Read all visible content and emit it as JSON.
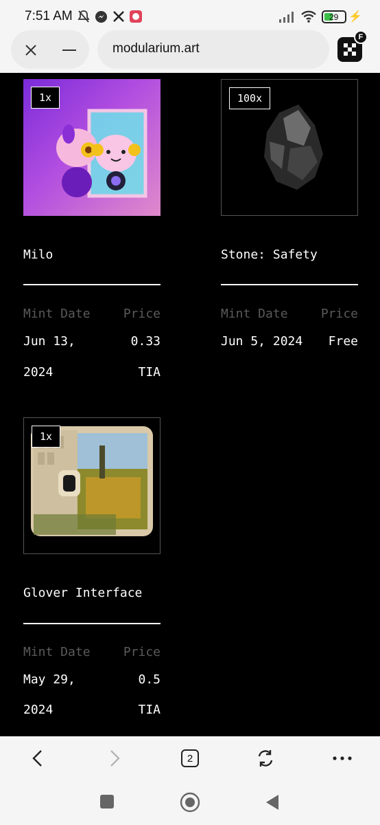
{
  "status_bar": {
    "time": "7:51 AM",
    "battery_level": "29",
    "icons": [
      "mute-icon",
      "messenger-icon",
      "x-icon",
      "app-icon",
      "signal-icon",
      "wifi-icon",
      "battery-icon",
      "charging-icon"
    ]
  },
  "browser": {
    "url": "modularium.art",
    "extension_badge": "F",
    "tab_count": "2"
  },
  "labels": {
    "mint_date": "Mint Date",
    "price": "Price"
  },
  "nfts": [
    {
      "quantity": "1x",
      "title": "Milo",
      "mint_date_line1": "Jun 13,",
      "mint_date_line2": "2024",
      "price_line1": "0.33",
      "price_line2": "TIA"
    },
    {
      "quantity": "100x",
      "title": "Stone: Safety",
      "mint_date_line1": "Jun 5, 2024",
      "mint_date_line2": "",
      "price_line1": "Free",
      "price_line2": ""
    },
    {
      "quantity": "1x",
      "title": "Glover Interface",
      "mint_date_line1": "May 29,",
      "mint_date_line2": "2024",
      "price_line1": "0.5",
      "price_line2": "TIA"
    }
  ],
  "colors": {
    "page_bg": "#000000",
    "chrome_bg": "#f5f5f5",
    "muted_label": "#5a5a5a"
  }
}
